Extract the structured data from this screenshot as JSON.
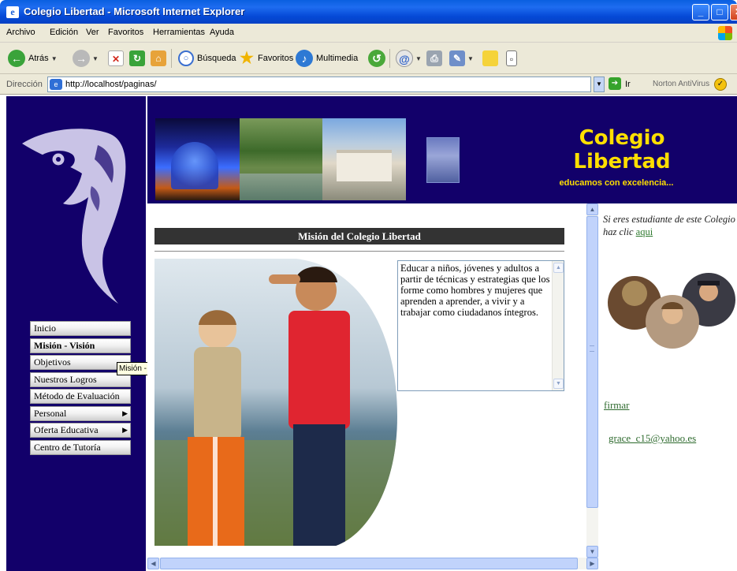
{
  "window": {
    "title": "Colegio Libertad - Microsoft Internet Explorer",
    "controls": {
      "minimize": "_",
      "maximize": "□",
      "close": "✕"
    }
  },
  "menubar": [
    "Archivo",
    "Edición",
    "Ver",
    "Favoritos",
    "Herramientas",
    "Ayuda"
  ],
  "toolbar": {
    "back": "Atrás",
    "search": "Búsqueda",
    "favorites": "Favoritos",
    "media": "Multimedia"
  },
  "address": {
    "label": "Dirección",
    "url": "http://localhost/paginas/",
    "go": "Ir",
    "norton": "Norton AntiVirus"
  },
  "banner": {
    "title_line1": "Colegio",
    "title_line2": "Libertad",
    "subtitle": "educamos con excelencia..."
  },
  "nav": {
    "items": [
      {
        "label": "Inicio"
      },
      {
        "label": "Misión - Visión"
      },
      {
        "label": "Objetivos"
      },
      {
        "label": "Nuestros Logros"
      },
      {
        "label": "Método de Evaluación"
      },
      {
        "label": "Personal"
      },
      {
        "label": "Oferta Educativa"
      },
      {
        "label": "Centro de Tutoría"
      }
    ],
    "tooltip": "Misión - Visión"
  },
  "main": {
    "heading": "Misión del Colegio Libertad",
    "mission_text": "Educar a niños, jóvenes y adultos a partir de técnicas y estrategias que los forme como hombres y mujeres que aprenden a aprender, a vivir y a trabajar como ciudadanos íntegros."
  },
  "sidebar": {
    "student_text": "Si eres estudiante de este Colegio haz clic",
    "student_link": "aqui",
    "sign_link": "firmar",
    "email": "grace_c15@yahoo.es"
  },
  "colors": {
    "navy": "#12006a",
    "banner_text": "#ffdf00",
    "link_green": "#2f6b2f"
  }
}
